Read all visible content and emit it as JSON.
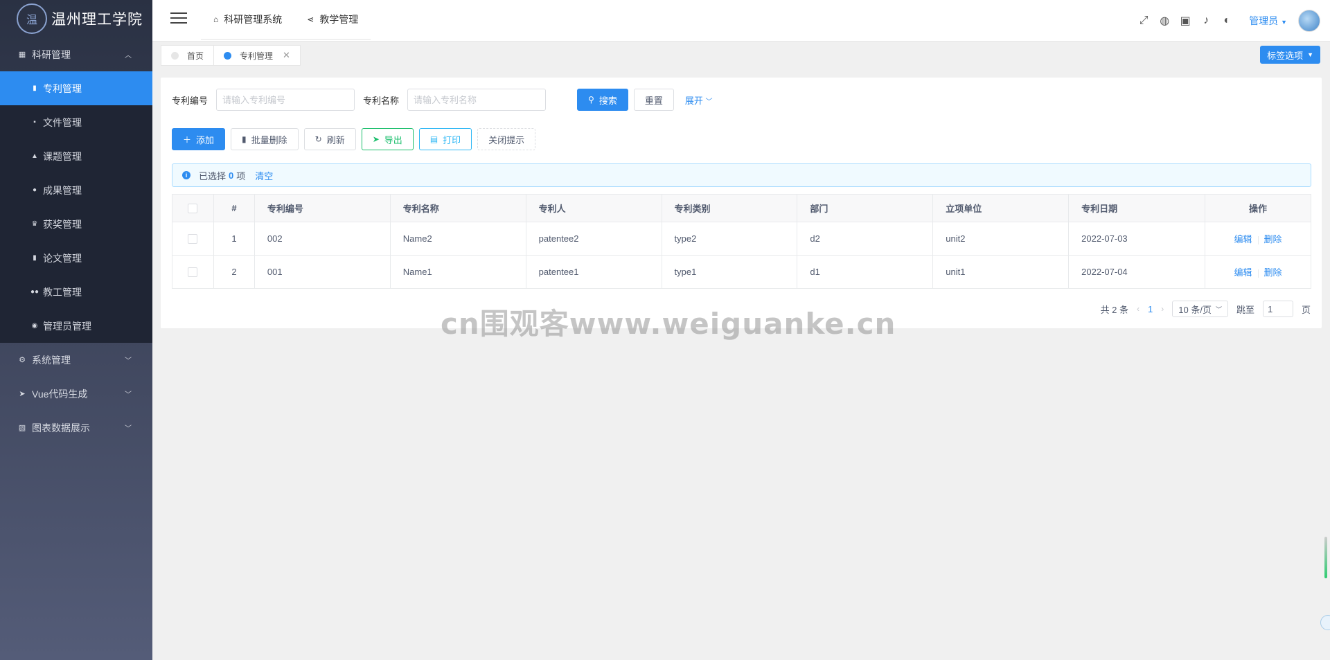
{
  "app": {
    "logo_text": "温州理工学院",
    "seal_char": "温"
  },
  "sidebar": {
    "groups": [
      {
        "label": "科研管理",
        "icon": "grid-icon",
        "expanded": true,
        "items": [
          {
            "label": "专利管理",
            "icon": "book-icon",
            "active": true
          },
          {
            "label": "文件管理",
            "icon": "file-icon"
          },
          {
            "label": "课题管理",
            "icon": "flask-icon"
          },
          {
            "label": "成果管理",
            "icon": "circle-icon"
          },
          {
            "label": "获奖管理",
            "icon": "trophy-icon"
          },
          {
            "label": "论文管理",
            "icon": "bookmark-icon"
          },
          {
            "label": "教工管理",
            "icon": "users-icon"
          },
          {
            "label": "管理员管理",
            "icon": "user-circle-icon"
          }
        ]
      },
      {
        "label": "系统管理",
        "icon": "gear-icon"
      },
      {
        "label": "Vue代码生成",
        "icon": "send-icon"
      },
      {
        "label": "图表数据展示",
        "icon": "chart-icon"
      }
    ]
  },
  "header": {
    "nav": [
      {
        "label": "科研管理系统",
        "icon": "home-icon"
      },
      {
        "label": "教学管理",
        "icon": "share-icon"
      }
    ],
    "user": "管理员"
  },
  "tabs": [
    {
      "label": "首页",
      "active": false
    },
    {
      "label": "专利管理",
      "active": true
    }
  ],
  "tab_options_label": "标签选项",
  "search": {
    "fields": [
      {
        "label": "专利编号",
        "placeholder": "请输入专利编号"
      },
      {
        "label": "专利名称",
        "placeholder": "请输入专利名称"
      }
    ],
    "search_label": "搜索",
    "reset_label": "重置",
    "expand_label": "展开"
  },
  "toolbar": {
    "add": "添加",
    "batch_delete": "批量删除",
    "refresh": "刷新",
    "export": "导出",
    "print": "打印",
    "close_tip": "关闭提示"
  },
  "selection": {
    "prefix": "已选择",
    "count": "0",
    "suffix": "项",
    "clear": "清空"
  },
  "table": {
    "columns": [
      "#",
      "专利编号",
      "专利名称",
      "专利人",
      "专利类别",
      "部门",
      "立项单位",
      "专利日期",
      "操作"
    ],
    "rows": [
      {
        "idx": "1",
        "code": "002",
        "name": "Name2",
        "patentee": "patentee2",
        "type": "type2",
        "dept": "d2",
        "unit": "unit2",
        "date": "2022-07-03"
      },
      {
        "idx": "2",
        "code": "001",
        "name": "Name1",
        "patentee": "patentee1",
        "type": "type1",
        "dept": "d1",
        "unit": "unit1",
        "date": "2022-07-04"
      }
    ],
    "edit_label": "编辑",
    "delete_label": "删除"
  },
  "pagination": {
    "total_text": "共 2 条",
    "current_page": "1",
    "page_size": "10 条/页",
    "jump_label": "跳至",
    "jump_value": "1",
    "page_suffix": "页"
  },
  "watermark": "cn围观客www.weiguanke.cn",
  "colors": {
    "primary": "#2d8cf0",
    "success": "#19be6b",
    "info": "#2db7f5",
    "sidebar_bg": "#2a3143"
  }
}
